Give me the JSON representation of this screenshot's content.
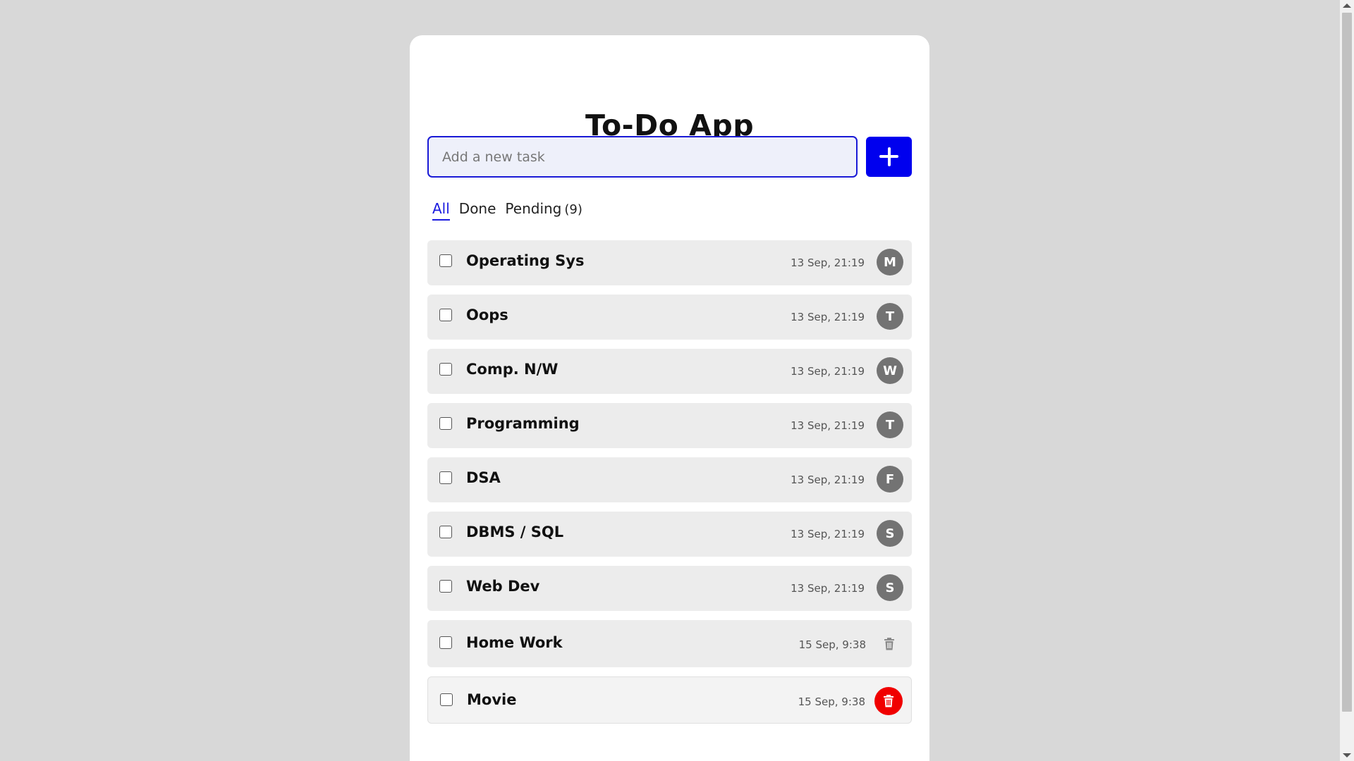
{
  "app": {
    "title": "To-Do App"
  },
  "input": {
    "placeholder": "Add a new task",
    "value": ""
  },
  "add_button": {
    "icon": "plus-icon"
  },
  "filters": [
    {
      "label": "All",
      "active": true
    },
    {
      "label": "Done",
      "active": false
    },
    {
      "label": "Pending",
      "count": "(9)",
      "active": false
    }
  ],
  "tasks": [
    {
      "name": "Operating Sys",
      "time": "13 Sep, 21:19",
      "avatar": "M"
    },
    {
      "name": "Oops",
      "time": "13 Sep, 21:19",
      "avatar": "T"
    },
    {
      "name": "Comp. N/W",
      "time": "13 Sep, 21:19",
      "avatar": "W"
    },
    {
      "name": "Programming",
      "time": "13 Sep, 21:19",
      "avatar": "T"
    },
    {
      "name": "DSA",
      "time": "13 Sep, 21:19",
      "avatar": "F"
    },
    {
      "name": "DBMS / SQL",
      "time": "13 Sep, 21:19",
      "avatar": "S"
    },
    {
      "name": "Web Dev",
      "time": "13 Sep, 21:19",
      "avatar": "S"
    },
    {
      "name": "Home Work",
      "time": "15 Sep, 9:38",
      "action_icon": "trash-icon"
    },
    {
      "name": "Movie",
      "time": "15 Sep, 9:38",
      "action_icon": "trash-icon",
      "action_color": "#f00000"
    }
  ],
  "colors": {
    "accent": "#0000ee",
    "background": "#d8d8d8",
    "avatar": "#737373",
    "danger": "#f00000"
  }
}
